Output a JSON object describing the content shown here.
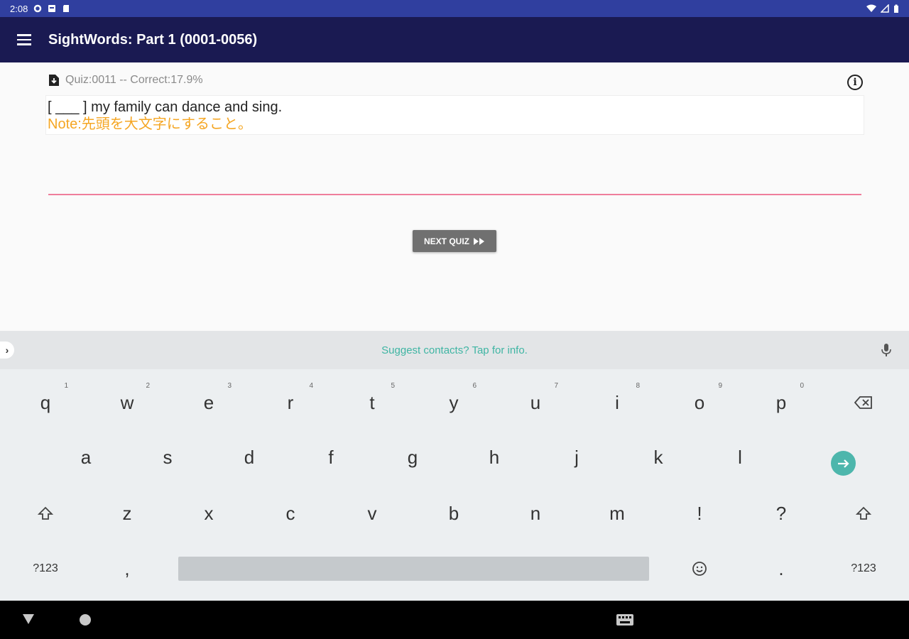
{
  "status_bar": {
    "time": "2:08"
  },
  "app_bar": {
    "title": "SightWords: Part 1 (0001-0056)"
  },
  "quiz": {
    "header": "Quiz:0011  -- Correct:17.9%",
    "question": "[ ___ ] my family can dance and sing.",
    "note": "Note:先頭を大文字にすること。",
    "next_button": "NEXT QUIZ"
  },
  "keyboard": {
    "suggestion": "Suggest contacts? Tap for info.",
    "row1": [
      {
        "key": "q",
        "hint": "1"
      },
      {
        "key": "w",
        "hint": "2"
      },
      {
        "key": "e",
        "hint": "3"
      },
      {
        "key": "r",
        "hint": "4"
      },
      {
        "key": "t",
        "hint": "5"
      },
      {
        "key": "y",
        "hint": "6"
      },
      {
        "key": "u",
        "hint": "7"
      },
      {
        "key": "i",
        "hint": "8"
      },
      {
        "key": "o",
        "hint": "9"
      },
      {
        "key": "p",
        "hint": "0"
      }
    ],
    "row2": [
      "a",
      "s",
      "d",
      "f",
      "g",
      "h",
      "j",
      "k",
      "l"
    ],
    "row3": [
      "z",
      "x",
      "c",
      "v",
      "b",
      "n",
      "m",
      "!",
      "?"
    ],
    "bottom": {
      "symbols_left": "?123",
      "comma": ",",
      "period": ".",
      "symbols_right": "?123"
    }
  },
  "colors": {
    "status_bar": "#303f9f",
    "app_bar": "#1a1a52",
    "note": "#f5a623",
    "answer_underline": "#ef7d9b",
    "accent": "#4db6ac"
  }
}
